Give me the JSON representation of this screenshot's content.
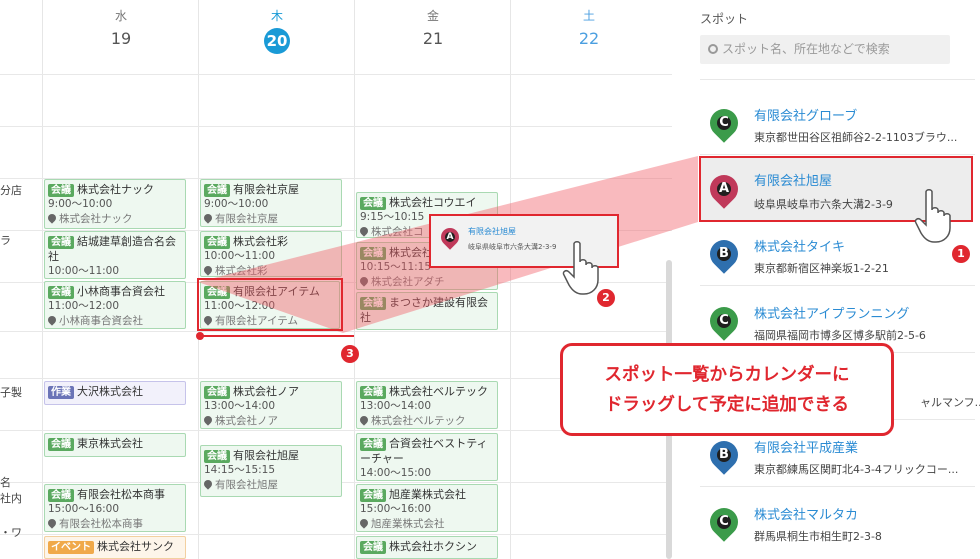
{
  "calendar": {
    "days": [
      {
        "dow": "水",
        "num": "19"
      },
      {
        "dow": "木",
        "num": "20"
      },
      {
        "dow": "金",
        "num": "21"
      },
      {
        "dow": "土",
        "num": "22"
      }
    ],
    "left_fragments": [
      "分店",
      "ラ",
      "子製",
      "名",
      "社内",
      "・ワ"
    ],
    "events": {
      "wed1": {
        "tag": "会議",
        "title": "株式会社ナック",
        "time": "9:00～10:00",
        "loc": "株式会社ナック"
      },
      "wed2": {
        "tag": "会議",
        "title": "結城建草創造合名会社",
        "time": "10:00～11:00"
      },
      "wed3": {
        "tag": "会議",
        "title": "小林商事合資会社",
        "time": "11:00～12:00",
        "loc": "小林商事合資会社"
      },
      "wed4": {
        "tag": "作業",
        "title": "大沢株式会社"
      },
      "wed5": {
        "tag": "会議",
        "title": "東京株式会社"
      },
      "wed6": {
        "tag": "会議",
        "title": "有限会社松本商事",
        "time": "15:00～16:00",
        "loc": "有限会社松本商事"
      },
      "wed7": {
        "tag": "イベント",
        "title": "株式会社サンク"
      },
      "thu1": {
        "tag": "会議",
        "title": "有限会社京屋",
        "time": "9:00～10:00",
        "loc": "有限会社京屋"
      },
      "thu2": {
        "tag": "会議",
        "title": "株式会社彩",
        "time": "10:00～11:00",
        "loc": "株式会社彩"
      },
      "thu3": {
        "tag": "会議",
        "title": "有限会社アイテム",
        "time": "11:00～12:00",
        "loc": "有限会社アイテム"
      },
      "thu4": {
        "tag": "会議",
        "title": "株式会社ノア",
        "time": "13:00～14:00",
        "loc": "株式会社ノア"
      },
      "thu5": {
        "tag": "会議",
        "title": "有限会社旭屋",
        "time": "14:15～15:15",
        "loc": "有限会社旭屋"
      },
      "fri1": {
        "tag": "会議",
        "title": "株式会社コウエイ",
        "time": "9:15～10:15",
        "loc": "株式会社コ"
      },
      "fri2": {
        "tag": "会議",
        "title": "株式会社",
        "time": "10:15～11:15",
        "loc": "株式会社アダチ"
      },
      "fri3": {
        "tag": "会議",
        "title": "まつさか建設有限会社"
      },
      "fri4": {
        "tag": "会議",
        "title": "株式会社ベルテック",
        "time": "13:00～14:00",
        "loc": "株式会社ベルテック"
      },
      "fri5": {
        "tag": "会議",
        "title": "合資会社ベストティーチャー",
        "time": "14:00～15:00"
      },
      "fri6": {
        "tag": "会議",
        "title": "旭産業株式会社",
        "time": "15:00～16:00",
        "loc": "旭産業株式会社"
      },
      "fri7": {
        "tag": "会議",
        "title": "株式会社ホクシン"
      }
    }
  },
  "panel": {
    "title": "スポット",
    "search_placeholder": "スポット名、所在地などで検索",
    "spots": [
      {
        "letter": "C",
        "color": "#3b9b4a",
        "name": "有限会社グローブ",
        "addr": "東京都世田谷区祖師谷2-2-1103ブラウ..."
      },
      {
        "letter": "A",
        "color": "#c0395a",
        "name": "有限会社旭屋",
        "addr": "岐阜県岐阜市六条大溝2-3-9"
      },
      {
        "letter": "B",
        "color": "#2e6fae",
        "name": "株式会社タイキ",
        "addr": "東京都新宿区神楽坂1-2-21"
      },
      {
        "letter": "C",
        "color": "#3b9b4a",
        "name": "株式会社アイプランニング",
        "addr": "福岡県福岡市博多区博多駅前2-5-6"
      },
      {
        "letter": "",
        "color": "#3b9b4a",
        "name": "",
        "addr": "ャルマンフ..."
      },
      {
        "letter": "B",
        "color": "#2e6fae",
        "name": "有限会社平成産業",
        "addr": "東京都練馬区関町北4-3-4フリックコー..."
      },
      {
        "letter": "C",
        "color": "#3b9b4a",
        "name": "株式会社マルタカ",
        "addr": "群馬県桐生市相生町2-3-8"
      }
    ]
  },
  "drag_ghost": {
    "letter": "A",
    "name": "有限会社旭屋",
    "addr": "岐阜県岐阜市六条大溝2-3-9"
  },
  "badges": [
    "1",
    "2",
    "3"
  ],
  "callout": {
    "line1": "スポット一覧からカレンダーに",
    "line2": "ドラッグして予定に追加できる"
  }
}
